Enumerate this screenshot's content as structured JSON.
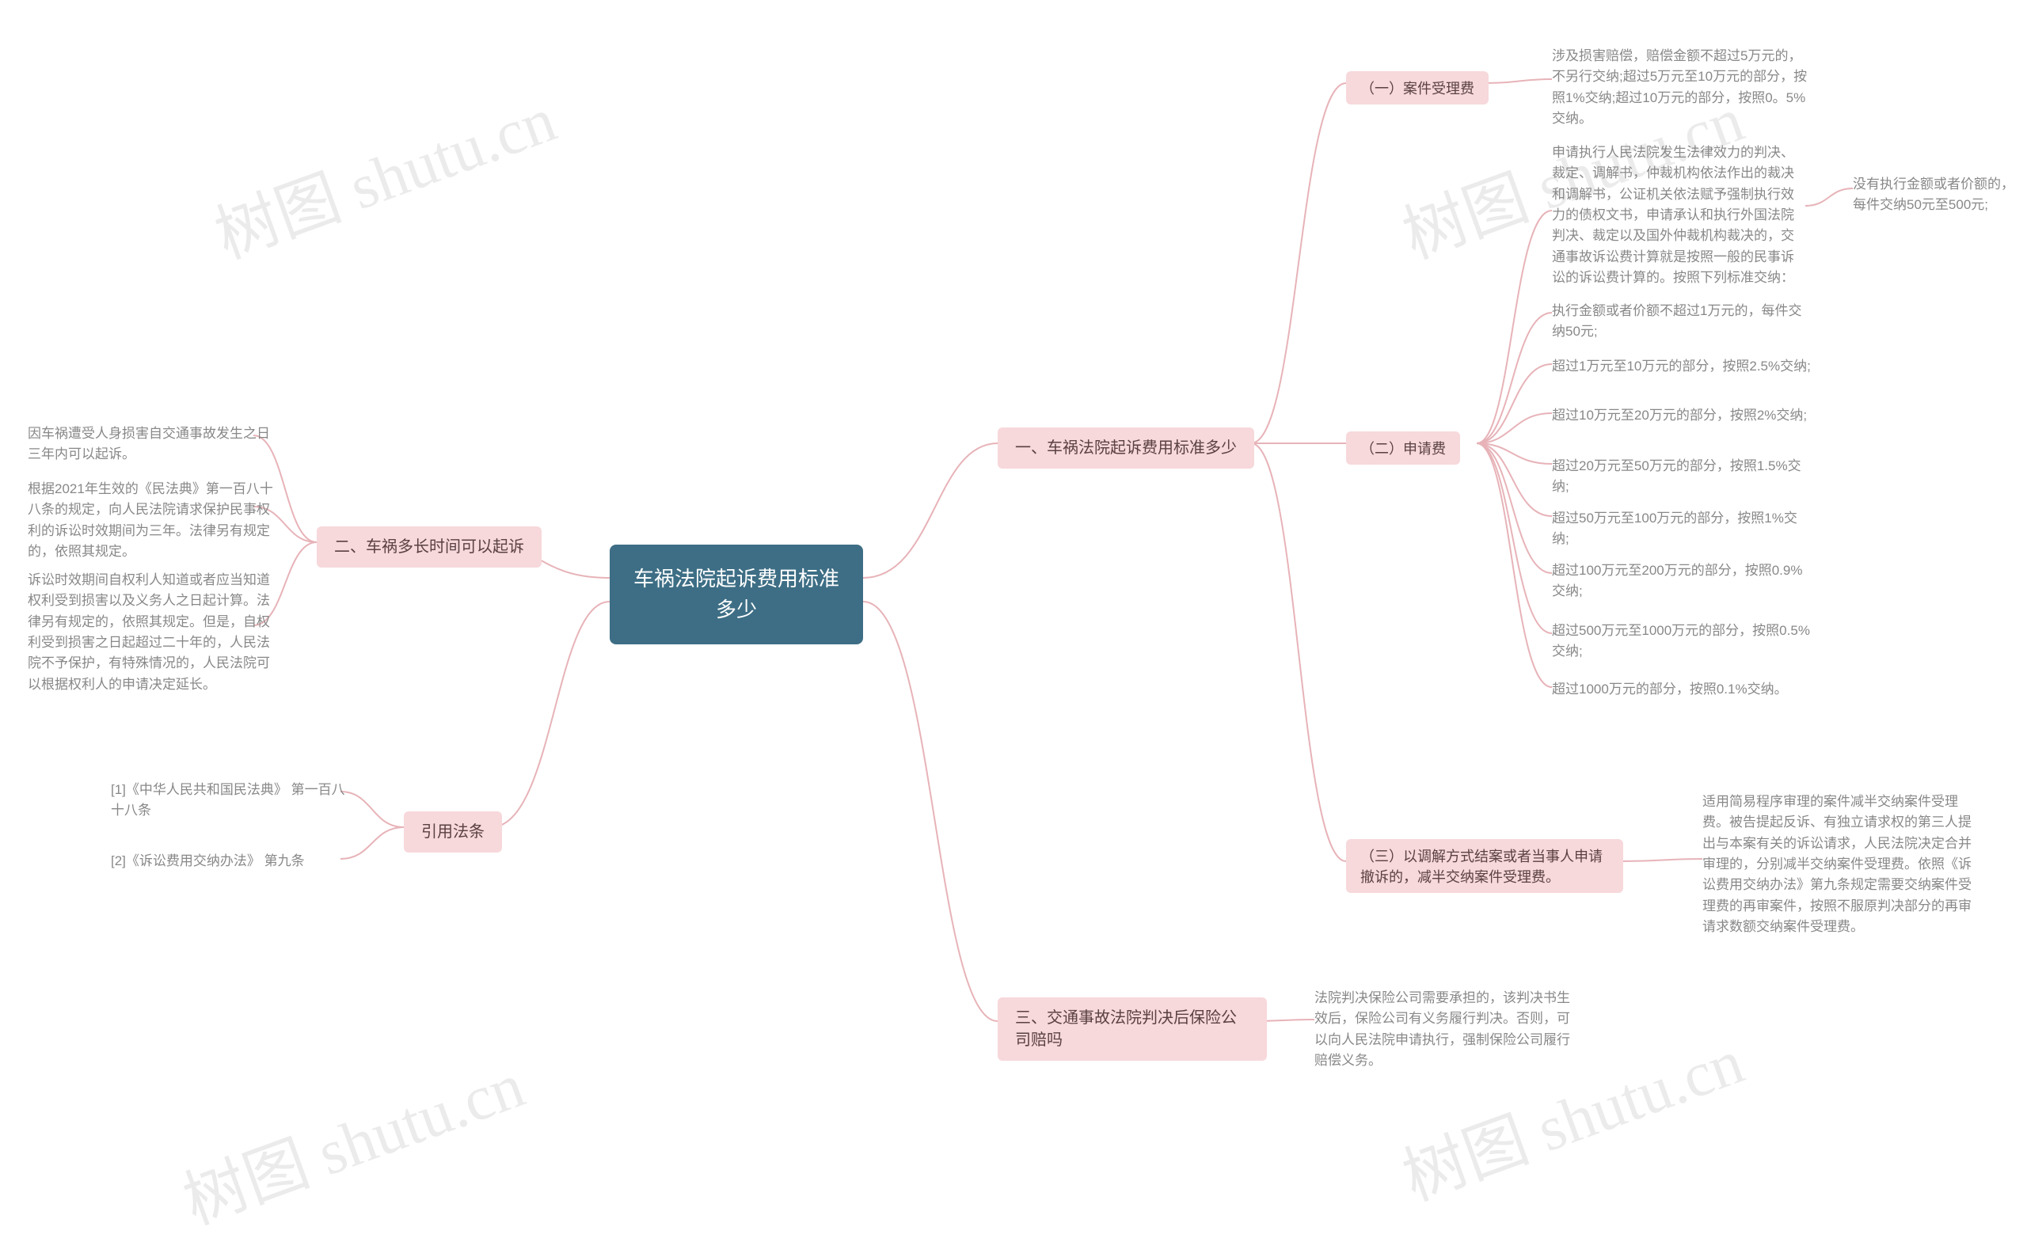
{
  "watermark": "树图 shutu.cn",
  "center": "车祸法院起诉费用标准多少",
  "right": {
    "sec1": {
      "title": "一、车祸法院起诉费用标准多少",
      "a": {
        "label": "（一）案件受理费",
        "text": "涉及损害赔偿，赔偿金额不超过5万元的，不另行交纳;超过5万元至10万元的部分，按照1%交纳;超过10万元的部分，按照0。5%交纳。"
      },
      "b": {
        "label": "（二）申请费",
        "intro": "申请执行人民法院发生法律效力的判决、裁定、调解书，仲裁机构依法作出的裁决和调解书，公证机关依法赋予强制执行效力的债权文书，申请承认和执行外国法院判决、裁定以及国外仲裁机构裁决的，交通事故诉讼费计算就是按照一般的民事诉讼的诉讼费计算的。按照下列标准交纳：",
        "intro_right": "没有执行金额或者价额的，每件交纳50元至500元;",
        "items": [
          "执行金额或者价额不超过1万元的，每件交纳50元;",
          "超过1万元至10万元的部分，按照2.5%交纳;",
          "超过10万元至20万元的部分，按照2%交纳;",
          "超过20万元至50万元的部分，按照1.5%交纳;",
          "超过50万元至100万元的部分，按照1%交纳;",
          "超过100万元至200万元的部分，按照0.9%交纳;",
          "超过500万元至1000万元的部分，按照0.5%交纳;",
          "超过1000万元的部分，按照0.1%交纳。"
        ]
      },
      "c": {
        "label": "（三）以调解方式结案或者当事人申请撤诉的，减半交纳案件受理费。",
        "text": "适用简易程序审理的案件减半交纳案件受理费。被告提起反诉、有独立请求权的第三人提出与本案有关的诉讼请求，人民法院决定合并审理的，分别减半交纳案件受理费。依照《诉讼费用交纳办法》第九条规定需要交纳案件受理费的再审案件，按照不服原判决部分的再审请求数额交纳案件受理费。"
      }
    },
    "sec3": {
      "title": "三、交通事故法院判决后保险公司赔吗",
      "text": "法院判决保险公司需要承担的，该判决书生效后，保险公司有义务履行判决。否则，可以向人民法院申请执行，强制保险公司履行赔偿义务。"
    }
  },
  "left": {
    "sec2": {
      "title": "二、车祸多长时间可以起诉",
      "items": [
        "因车祸遭受人身损害自交通事故发生之日三年内可以起诉。",
        "根据2021年生效的《民法典》第一百八十八条的规定，向人民法院请求保护民事权利的诉讼时效期间为三年。法律另有规定的，依照其规定。",
        "诉讼时效期间自权利人知道或者应当知道权利受到损害以及义务人之日起计算。法律另有规定的，依照其规定。但是，自权利受到损害之日起超过二十年的，人民法院不予保护，有特殊情况的，人民法院可以根据权利人的申请决定延长。"
      ]
    },
    "law": {
      "title": "引用法条",
      "items": [
        "[1]《中华人民共和国民法典》 第一百八十八条",
        "[2]《诉讼费用交纳办法》 第九条"
      ]
    }
  }
}
